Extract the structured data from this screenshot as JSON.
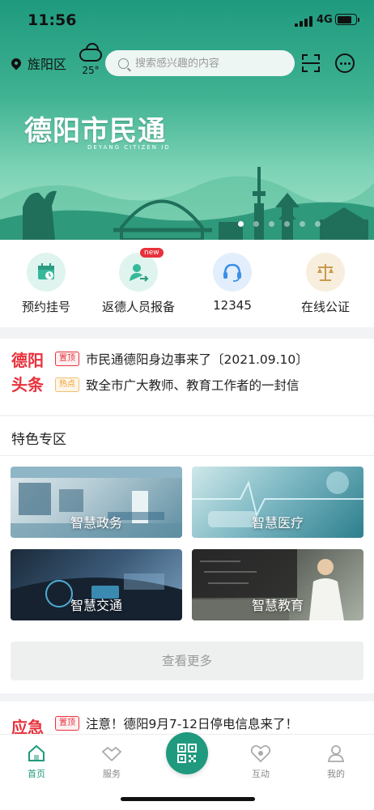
{
  "status_bar": {
    "time": "11:56",
    "network": "4G"
  },
  "header": {
    "location": "旌阳区",
    "weather": {
      "icon": "cloud-icon",
      "temperature": "25°"
    },
    "search_placeholder": "搜索感兴趣的内容"
  },
  "banner": {
    "title": "德阳市民通",
    "subtitle": "DEYANG CITIZEN ID",
    "page_count": 6,
    "active_page": 1
  },
  "quick_entries": [
    {
      "label": "预约挂号",
      "icon": "calendar-clock-icon",
      "color": "#36b89a"
    },
    {
      "label": "返德人员报备",
      "icon": "person-return-icon",
      "color": "#36b89a",
      "badge": "new"
    },
    {
      "label": "12345",
      "icon": "headset-icon",
      "color": "#3a8fe8"
    },
    {
      "label": "在线公证",
      "icon": "scales-icon",
      "color": "#c99a4e"
    }
  ],
  "headlines": {
    "brand_line1": "德阳",
    "brand_line2": "头条",
    "items": [
      {
        "tag": "置顶",
        "text": "市民通德阳身边事来了〔2021.09.10〕"
      },
      {
        "tag": "热点",
        "text": "致全市广大教师、教育工作者的一封信"
      }
    ]
  },
  "feature_zone": {
    "title": "特色专区",
    "tiles": [
      {
        "label": "智慧政务"
      },
      {
        "label": "智慧医疗"
      },
      {
        "label": "智慧交通"
      },
      {
        "label": "智慧教育"
      }
    ],
    "more_label": "查看更多"
  },
  "emergency": {
    "brand": "应急",
    "tag": "置顶",
    "text": "注意！德阳9月7-12日停电信息来了！"
  },
  "tabbar": {
    "items": [
      {
        "label": "首页",
        "icon": "home-icon",
        "active": true
      },
      {
        "label": "服务",
        "icon": "handshake-icon",
        "active": false
      },
      {
        "label": "互动",
        "icon": "interaction-icon",
        "active": false
      },
      {
        "label": "我的",
        "icon": "user-icon",
        "active": false
      }
    ],
    "center_icon": "qr-code-icon"
  },
  "colors": {
    "brand": "#1f9a7e",
    "accent_red": "#e8313c",
    "hot_orange": "#f0a030"
  }
}
